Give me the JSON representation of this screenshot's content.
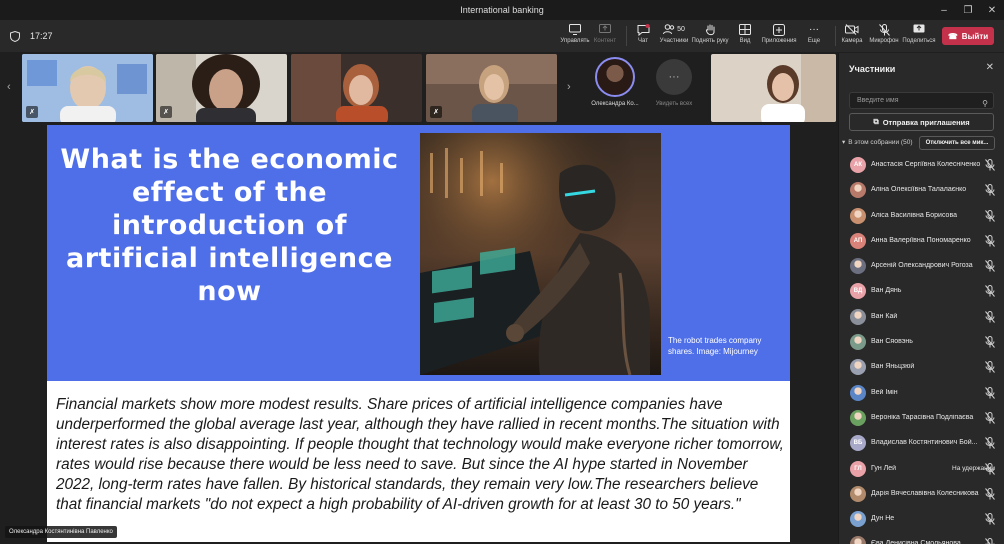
{
  "window": {
    "title": "International banking"
  },
  "toolbar": {
    "timer": "17:27",
    "buttons": [
      {
        "id": "manage",
        "label": "Управлять",
        "icon": "manage-icon",
        "enabled": true
      },
      {
        "id": "content",
        "label": "Контент",
        "icon": "share-content-icon",
        "enabled": false
      },
      {
        "id": "chat",
        "label": "Чат",
        "icon": "chat-icon",
        "enabled": true
      },
      {
        "id": "participants",
        "label": "Участники",
        "icon": "people-icon",
        "enabled": true,
        "count": "50"
      },
      {
        "id": "raise",
        "label": "Поднять руку",
        "icon": "raise-hand-icon",
        "enabled": true
      },
      {
        "id": "view",
        "label": "Вид",
        "icon": "view-icon",
        "enabled": true
      },
      {
        "id": "apps",
        "label": "Приложения",
        "icon": "apps-icon",
        "enabled": true
      },
      {
        "id": "more",
        "label": "Еще",
        "icon": "more-icon",
        "enabled": true
      },
      {
        "id": "camera",
        "label": "Камера",
        "icon": "camera-off-icon",
        "enabled": true
      },
      {
        "id": "mic",
        "label": "Микрофон",
        "icon": "mic-off-icon",
        "enabled": true
      },
      {
        "id": "share",
        "label": "Поделиться",
        "icon": "share-screen-icon",
        "enabled": true
      }
    ],
    "leave_label": "Выйти"
  },
  "strip": {
    "avatar_name": "Олександра Ко...",
    "show_all_label": "Увидеть всех"
  },
  "slide": {
    "title": "What is the economic effect of the introduction of artificial intelligence now",
    "caption": "The robot trades company shares. Image: Mijourney",
    "body": "Financial markets show more modest results. Share prices of artificial intelligence companies have underperformed the global average last year, although they have rallied in recent months.The situation with interest rates is also disappointing. If people thought that technology would make everyone richer tomorrow, rates would rise because there would be less need to save. But since the AI hype started in November 2022, long-term rates have fallen. By historical standards, they remain very low.The researchers believe that financial markets \"do not expect a high probability of AI-driven growth for at least 30 to 50 years.\""
  },
  "presenter": {
    "name": "Олександра Костянтинівна Павленко"
  },
  "panel": {
    "title": "Участники",
    "search_placeholder": "Введите имя",
    "invite_label": "Отправка приглашения",
    "section_label": "В этом собрании (50)",
    "mute_all_label": "Отключить все мик...",
    "participants": [
      {
        "initials": "АК",
        "name": "Анастасія Сергіївна Колесніченко",
        "color": "#e8a2a8",
        "photo": false,
        "status": ""
      },
      {
        "initials": "",
        "name": "Аліна Олексіївна Талалаєнко",
        "color": "#b77a6a",
        "photo": true,
        "status": ""
      },
      {
        "initials": "",
        "name": "Аліса Василівна Борисова",
        "color": "#c99070",
        "photo": true,
        "status": ""
      },
      {
        "initials": "АП",
        "name": "Анна Валеріївна Пономаренко",
        "color": "#d9827a",
        "photo": false,
        "status": ""
      },
      {
        "initials": "",
        "name": "Арсеній Олександрович Рогоза",
        "color": "#6c6f80",
        "photo": true,
        "status": ""
      },
      {
        "initials": "ВД",
        "name": "Ван Дянь",
        "color": "#e8a2a8",
        "photo": false,
        "status": ""
      },
      {
        "initials": "",
        "name": "Ван Кай",
        "color": "#8a8f9a",
        "photo": true,
        "status": ""
      },
      {
        "initials": "",
        "name": "Ван Сяовэнь",
        "color": "#7a9a8a",
        "photo": true,
        "status": ""
      },
      {
        "initials": "",
        "name": "Ван Яньцзюй",
        "color": "#9aa0b0",
        "photo": true,
        "status": ""
      },
      {
        "initials": "",
        "name": "Вей Імін",
        "color": "#5a86c8",
        "photo": true,
        "status": ""
      },
      {
        "initials": "",
        "name": "Вероніка Тарасівна Подліпаєва",
        "color": "#6aa060",
        "photo": true,
        "status": ""
      },
      {
        "initials": "ВБ",
        "name": "Владислав Костянтинович Бой...",
        "color": "#a8a8c8",
        "photo": false,
        "status": ""
      },
      {
        "initials": "ГЛ",
        "name": "Гун Лей",
        "color": "#e8a2a8",
        "photo": false,
        "status": "На удержании"
      },
      {
        "initials": "",
        "name": "Дарія Вячеславівна Колесникова",
        "color": "#b08a6a",
        "photo": true,
        "status": ""
      },
      {
        "initials": "",
        "name": "Дун Не",
        "color": "#7aa0d0",
        "photo": true,
        "status": ""
      },
      {
        "initials": "",
        "name": "Єва Денисівна Смольянова",
        "color": "#9a7a6a",
        "photo": true,
        "status": ""
      }
    ]
  },
  "colors": {
    "slide_blue": "#4f6fe8",
    "leave_red": "#c4314b",
    "accent_purple": "#8b8cf0"
  }
}
